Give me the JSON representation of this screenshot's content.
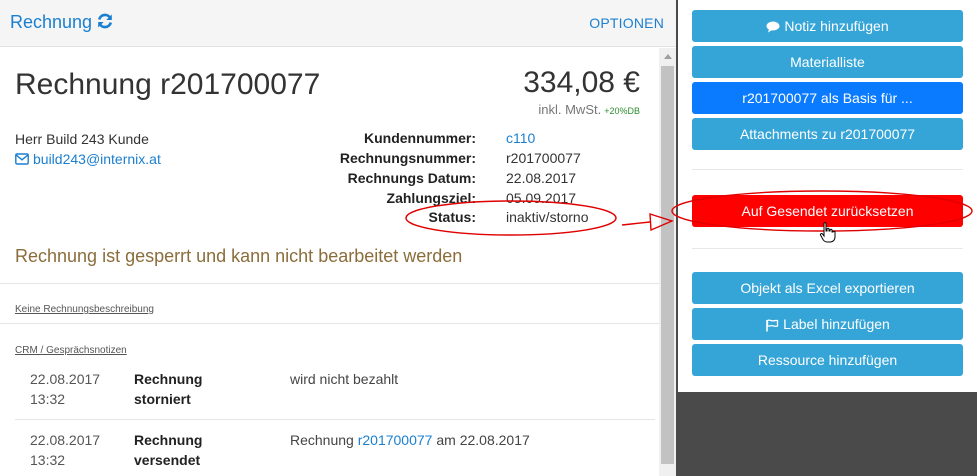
{
  "header": {
    "title": "Rechnung",
    "options_label": "OPTIONEN"
  },
  "invoice": {
    "title": "Rechnung r201700077",
    "amount": "334,08 €",
    "tax_note": "inkl. MwSt.",
    "db_note": "+20%DB",
    "customer_name": "Herr Build 243 Kunde",
    "customer_email": "build243@internix.at",
    "fields": [
      {
        "label": "Kundennummer:",
        "value": "c110",
        "link": true
      },
      {
        "label": "Rechnungsnummer:",
        "value": "r201700077",
        "link": false
      },
      {
        "label": "Rechnungs Datum:",
        "value": "22.08.2017",
        "link": false
      },
      {
        "label": "Zahlungsziel:",
        "value": "05.09.2017",
        "link": false
      },
      {
        "label": "Status:",
        "value": "inaktiv/storno",
        "link": false
      }
    ],
    "locked_message": "Rechnung ist gesperrt und kann nicht bearbeitet werden",
    "description_link": "Keine Rechnungsbeschreibung",
    "crm_link": "CRM / Gesprächsnotizen"
  },
  "crm_entries": [
    {
      "date": "22.08.2017",
      "time": "13:32",
      "type_line1": "Rechnung",
      "type_line2": "storniert",
      "text": "wird nicht bezahlt"
    },
    {
      "date": "22.08.2017",
      "time": "13:32",
      "type_line1": "Rechnung",
      "type_line2": "versendet",
      "text_prefix": "Rechnung ",
      "text_link": "r201700077",
      "text_suffix": " am 22.08.2017"
    }
  ],
  "sidebar": {
    "buttons": [
      {
        "label": "Notiz hinzufügen",
        "icon": "comment-icon"
      },
      {
        "label": "Materialliste"
      },
      {
        "label": "r201700077 als Basis für ..."
      },
      {
        "label": "Attachments zu r201700077"
      },
      {
        "label": "Auf Gesendet zurücksetzen"
      },
      {
        "label": "Objekt als Excel exportieren"
      },
      {
        "label": "Label hinzufügen",
        "icon": "flag-icon"
      },
      {
        "label": "Ressource hinzufügen"
      }
    ]
  },
  "colors": {
    "link": "#1b7fd0",
    "button": "#35a5d8",
    "button_primary": "#0a7bff",
    "button_danger": "#ff0000",
    "warning_text": "#8a6d3b",
    "annotation": "#e00000"
  }
}
